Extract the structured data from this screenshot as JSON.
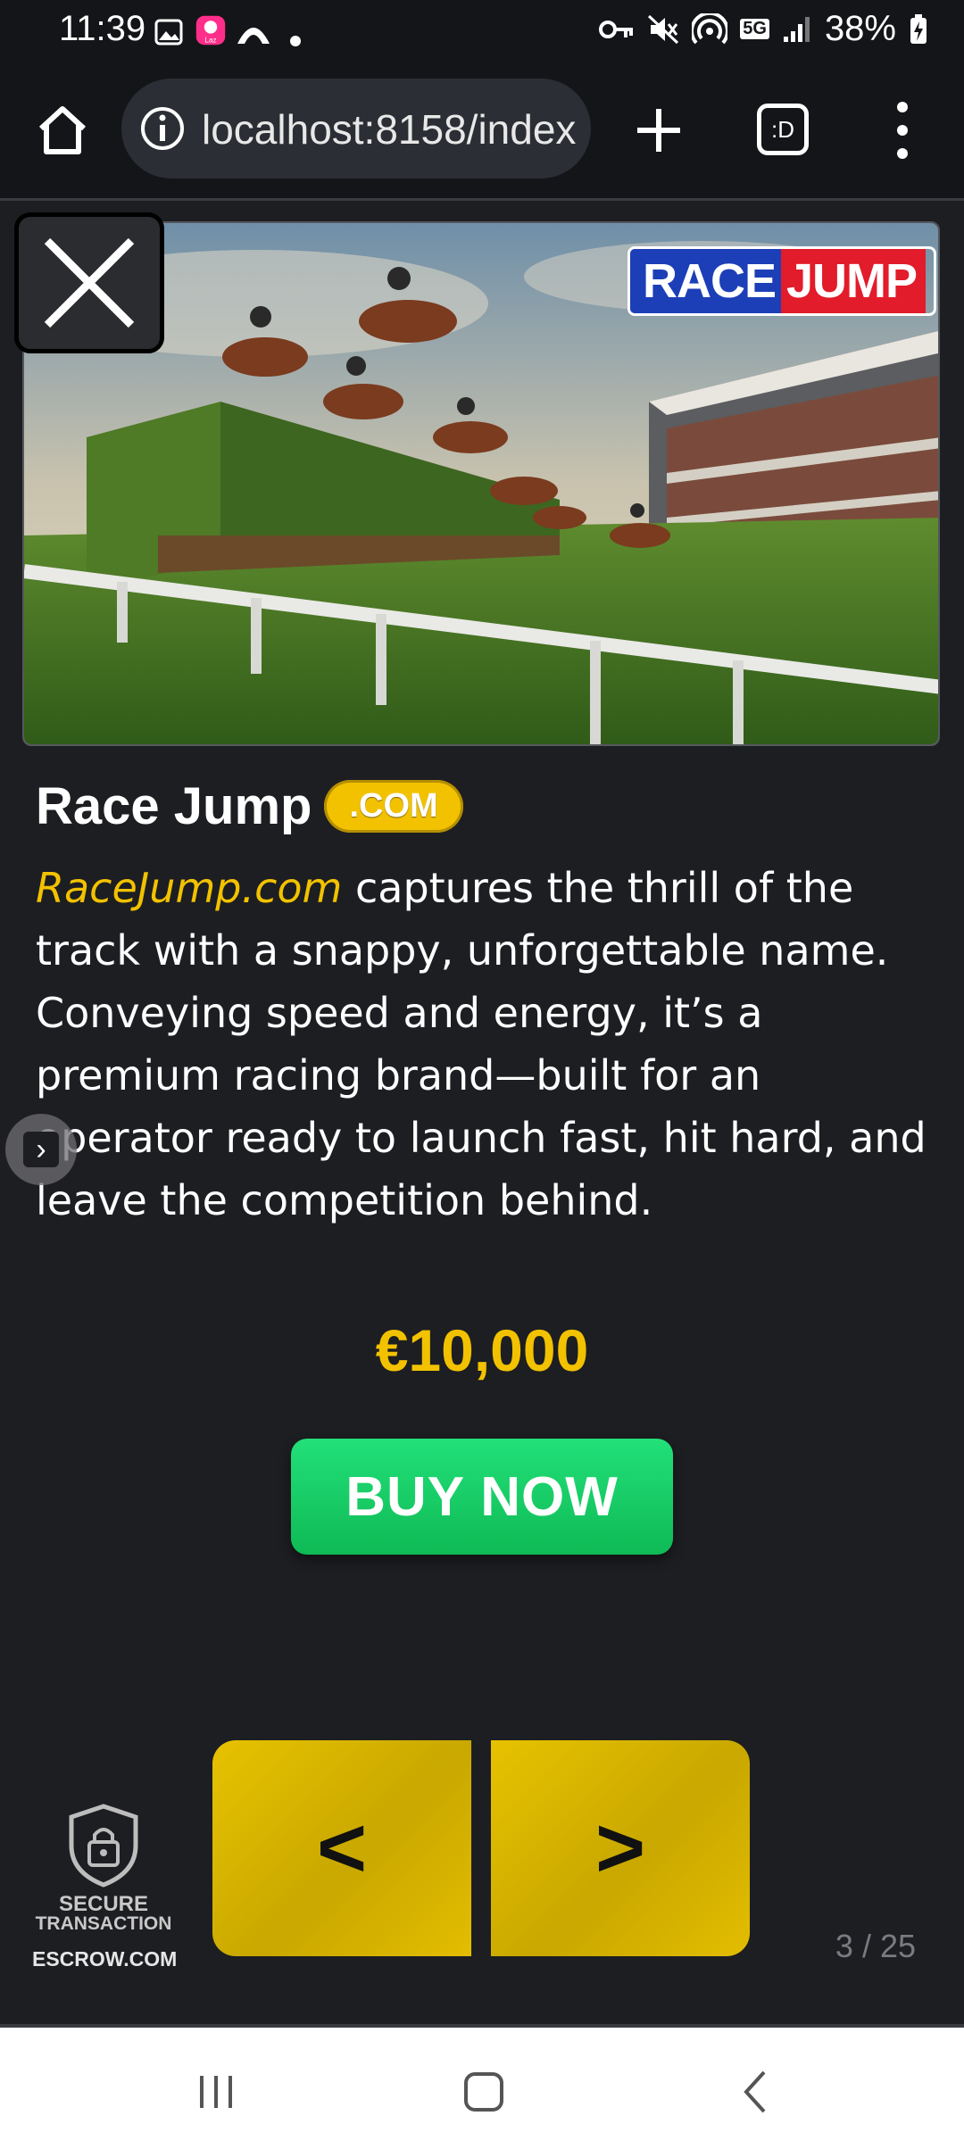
{
  "status_bar": {
    "time": "11:39",
    "battery": "38%",
    "network": "5G"
  },
  "browser": {
    "url": "localhost:8158/index",
    "tabs_label": ":D"
  },
  "hero": {
    "brand_part1": "RACE",
    "brand_part2": "JUMP"
  },
  "listing": {
    "title": "Race Jump",
    "tld": ".COM",
    "description_link": "RaceJump.com",
    "description_body": " captures the thrill of the track with a snappy, unforgettable name. Conveying speed and energy, it’s a premium racing brand—built for an operator ready to launch fast, hit hard, and leave the competition behind.",
    "price": "€10,000",
    "buy_label": "BUY NOW"
  },
  "pager": {
    "prev_label": "<",
    "next_label": ">",
    "counter": "3 / 25"
  },
  "escrow": {
    "line1": "SECURE",
    "line2": "TRANSACTION",
    "line3": "ESCROW.COM"
  },
  "colors": {
    "accent_yellow": "#f2c200",
    "buy_green": "#14c862",
    "background": "#1d1e22"
  }
}
